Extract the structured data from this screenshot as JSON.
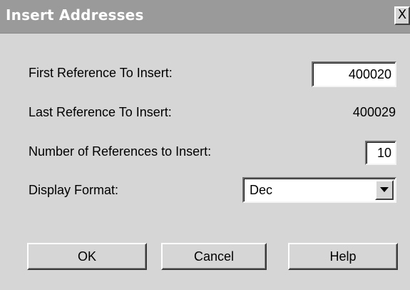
{
  "window": {
    "title": "Insert Addresses",
    "close_label": "X"
  },
  "form": {
    "first_reference": {
      "label": "First Reference To Insert:",
      "value": "400020"
    },
    "last_reference": {
      "label": "Last Reference To Insert:",
      "value": "400029"
    },
    "count": {
      "label": "Number of References to Insert:",
      "value": "10"
    },
    "display_format": {
      "label": "Display Format:",
      "selected": "Dec"
    }
  },
  "buttons": {
    "ok": "OK",
    "cancel": "Cancel",
    "help": "Help"
  },
  "icons": {
    "combo_arrow": "chevron-down-icon",
    "close": "close-icon"
  }
}
